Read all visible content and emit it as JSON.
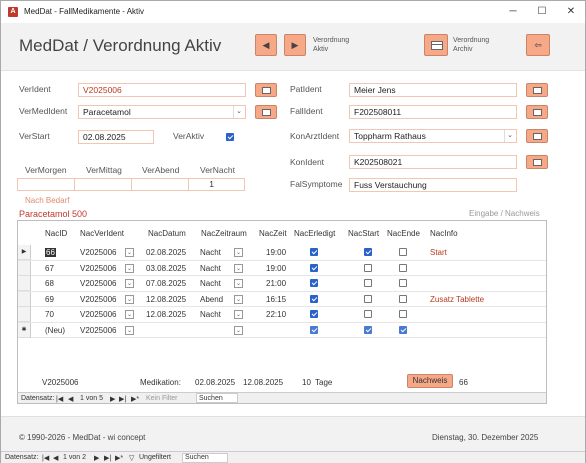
{
  "window": {
    "title": "MedDat - FallMedikamente - Aktiv",
    "app_icon": "A",
    "minimize": "─",
    "maximize": "☐",
    "close": "✕"
  },
  "header": {
    "title": "MedDat / Verordnung Aktiv",
    "prev_glyph": "◀",
    "next_glyph": "▶",
    "verordnung_aktiv_line1": "Verordnung",
    "verordnung_aktiv_line2": "Aktiv",
    "verordnung_archiv_line1": "Verordnung",
    "verordnung_archiv_line2": "Archiv",
    "exit_glyph": "⇦"
  },
  "form": {
    "verident_label": "VerIdent",
    "verident_value": "V2025006",
    "vermedident_label": "VerMedIdent",
    "vermedident_value": "Paracetamol",
    "verstart_label": "VerStart",
    "verstart_value": "02.08.2025",
    "veraktiv_label": "VerAktiv",
    "patident_label": "PatIdent",
    "patident_value": "Meier Jens",
    "fallident_label": "FallIdent",
    "fallident_value": "F202508011",
    "konarztident_label": "KonArztIdent",
    "konarztident_value": "Toppharm Rathaus",
    "konident_label": "KonIdent",
    "konident_value": "K202508021",
    "falsymptome_label": "FalSymptome",
    "falsymptome_value": "Fuss Verstauchung",
    "dosage_headers": [
      "VerMorgen",
      "VerMittag",
      "VerAbend",
      "VerNacht"
    ],
    "dosage_values": [
      "",
      "",
      "",
      "1"
    ],
    "nach_bedarf": "Nach Bedarf",
    "drug_caption": "Paracetamol 500",
    "eingabe_nachweis": "Eingabe / Nachweis"
  },
  "subform": {
    "columns": [
      "NacID",
      "NacVerIdent",
      "NacDatum",
      "NacZeitraum",
      "NacZeit",
      "NacErledigt",
      "NacStart",
      "NacEnde",
      "NacInfo"
    ],
    "rows": [
      {
        "id": "66",
        "ver": "V2025006",
        "datum": "02.08.2025",
        "zeitraum": "Nacht",
        "zeit": "19:00",
        "erledigt": true,
        "start": true,
        "ende": false,
        "info": "Start"
      },
      {
        "id": "67",
        "ver": "V2025006",
        "datum": "03.08.2025",
        "zeitraum": "Nacht",
        "zeit": "19:00",
        "erledigt": true,
        "start": false,
        "ende": false,
        "info": ""
      },
      {
        "id": "68",
        "ver": "V2025006",
        "datum": "07.08.2025",
        "zeitraum": "Nacht",
        "zeit": "21:00",
        "erledigt": true,
        "start": false,
        "ende": false,
        "info": ""
      },
      {
        "id": "69",
        "ver": "V2025006",
        "datum": "12.08.2025",
        "zeitraum": "Abend",
        "zeit": "16:15",
        "erledigt": true,
        "start": false,
        "ende": false,
        "info": "Zusatz Tablette"
      },
      {
        "id": "70",
        "ver": "V2025006",
        "datum": "12.08.2025",
        "zeitraum": "Nacht",
        "zeit": "22:10",
        "erledigt": true,
        "start": false,
        "ende": false,
        "info": ""
      }
    ],
    "new_row": {
      "id": "(Neu)",
      "ver": "V2025006"
    },
    "footer_ver": "V2025006",
    "footer_medikation_label": "Medikation:",
    "footer_start": "02.08.2025",
    "footer_end": "12.08.2025",
    "footer_days": "10",
    "footer_tage": "Tage",
    "nachweis_button": "Nachweis",
    "nachweis_count": "66",
    "nav": {
      "label": "Datensatz:",
      "first": "|◀",
      "prev": "◀",
      "pos": "1 von 5",
      "next": "▶",
      "last": "▶|",
      "new": "▶*",
      "filter": "Kein Filter",
      "search": "Suchen"
    }
  },
  "footer": {
    "copyright": "© 1990-2026 - MedDat - wi concept",
    "date": "Dienstag, 30. Dezember 2025"
  },
  "statusbar": {
    "label": "Datensatz:",
    "first": "|◀",
    "prev": "◀",
    "pos": "1 von 2",
    "next": "▶",
    "last": "▶|",
    "new": "▶*",
    "filter": "Ungefiltert",
    "search": "Suchen"
  }
}
